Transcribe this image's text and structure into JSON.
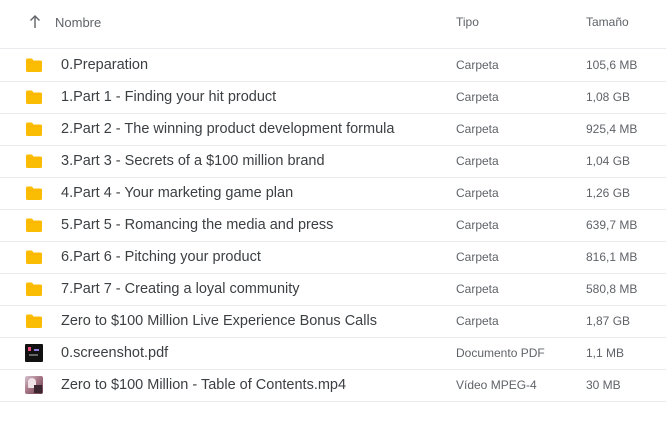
{
  "header": {
    "sort_icon": "arrow-up-icon",
    "name": "Nombre",
    "type": "Tipo",
    "size": "Tamaño"
  },
  "colors": {
    "folder": "#fbbc04",
    "folder_tab": "#f9ab00",
    "divider": "#e8eaed"
  },
  "files": [
    {
      "name": "0.Preparation",
      "type": "Carpeta",
      "size": "105,6 MB",
      "icon": "folder-icon"
    },
    {
      "name": "1.Part 1 - Finding your hit product",
      "type": "Carpeta",
      "size": "1,08 GB",
      "icon": "folder-icon"
    },
    {
      "name": "2.Part 2 - The winning product development formula",
      "type": "Carpeta",
      "size": "925,4 MB",
      "icon": "folder-icon"
    },
    {
      "name": "3.Part 3 - Secrets of a $100 million brand",
      "type": "Carpeta",
      "size": "1,04 GB",
      "icon": "folder-icon"
    },
    {
      "name": "4.Part 4 - Your marketing game plan",
      "type": "Carpeta",
      "size": "1,26 GB",
      "icon": "folder-icon"
    },
    {
      "name": "5.Part 5 - Romancing the media and press",
      "type": "Carpeta",
      "size": "639,7 MB",
      "icon": "folder-icon"
    },
    {
      "name": "6.Part 6 - Pitching your product",
      "type": "Carpeta",
      "size": "816,1 MB",
      "icon": "folder-icon"
    },
    {
      "name": "7.Part 7 - Creating a loyal community",
      "type": "Carpeta",
      "size": "580,8 MB",
      "icon": "folder-icon"
    },
    {
      "name": "Zero to $100 Million Live Experience Bonus Calls",
      "type": "Carpeta",
      "size": "1,87 GB",
      "icon": "folder-icon"
    },
    {
      "name": "0.screenshot.pdf",
      "type": "Documento PDF",
      "size": "1,1 MB",
      "icon": "pdf-thumbnail-icon"
    },
    {
      "name": "Zero to $100 Million - Table of Contents.mp4",
      "type": "Vídeo MPEG-4",
      "size": "30 MB",
      "icon": "video-thumbnail-icon"
    }
  ]
}
